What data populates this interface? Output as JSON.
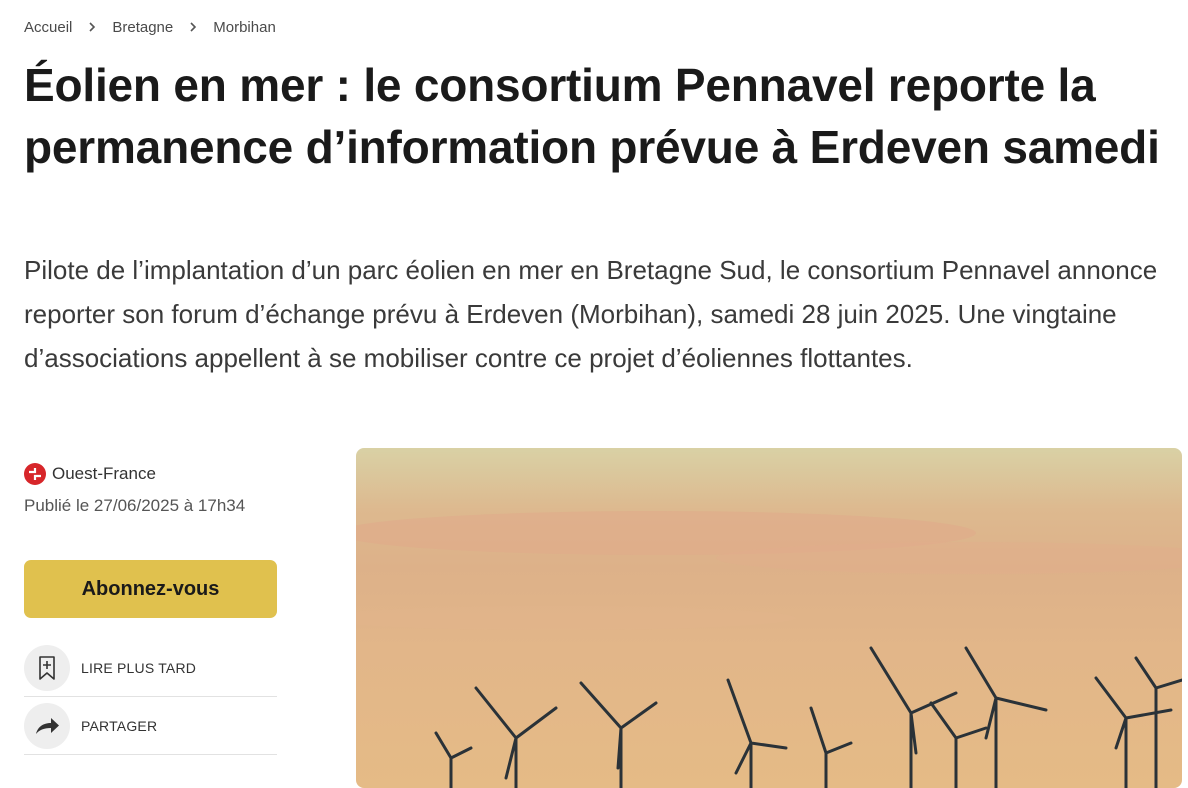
{
  "breadcrumb": {
    "items": [
      "Accueil",
      "Bretagne",
      "Morbihan"
    ]
  },
  "article": {
    "title": "Éolien en mer : le consortium Pennavel reporte la permanence d’information prévue à Erdeven samedi",
    "lead": "Pilote de l’implantation d’un parc éolien en mer en Bretagne Sud, le consortium Pennavel annonce reporter son forum d’échange prévu à Erdeven (Morbihan), samedi 28 juin 2025. Une vingtaine d’associations appellent à se mobiliser contre ce projet d’éoliennes flottantes."
  },
  "meta": {
    "source": "Ouest-France",
    "published": "Publié le 27/06/2025 à 17h34",
    "source_icon": "ouest-france-logo-icon",
    "source_color": "#d7262a"
  },
  "actions": {
    "subscribe_label": "Abonnez-vous",
    "subscribe_color": "#e0c14e",
    "read_later_label": "LIRE PLUS TARD",
    "read_later_icon": "bookmark-plus-icon",
    "share_label": "PARTAGER",
    "share_icon": "share-arrow-icon"
  },
  "hero_image": {
    "subject": "offshore-wind-turbines-at-sunset"
  }
}
